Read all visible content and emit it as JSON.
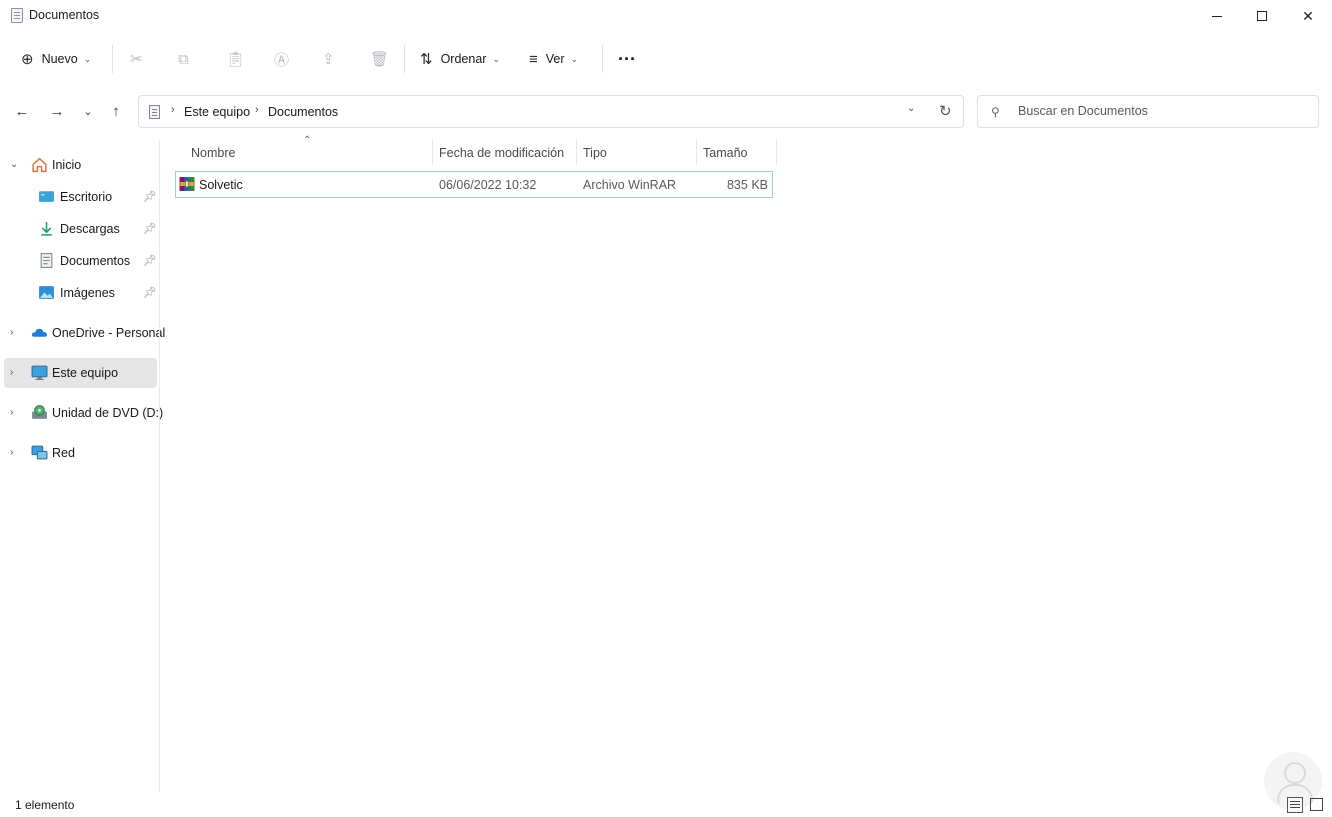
{
  "window": {
    "title": "Documentos",
    "minimize": "—",
    "maximize": "☐",
    "close": "✕"
  },
  "toolbar": {
    "new_label": "Nuevo",
    "sort_label": "Ordenar",
    "view_label": "Ver",
    "more_label": "···",
    "icons": [
      "plus-circle-icon",
      "cut-icon",
      "copy-icon",
      "paste-icon",
      "rename-icon",
      "share-icon",
      "delete-icon",
      "sort-icon",
      "view-icon",
      "more-icon"
    ]
  },
  "address": {
    "crumbs": [
      "Este equipo",
      "Documentos"
    ],
    "separator": "›"
  },
  "search": {
    "placeholder": "Buscar en Documentos"
  },
  "sidebar": {
    "items": [
      {
        "label": "Inicio",
        "icon": "home-icon",
        "expanded": true
      },
      {
        "label": "Escritorio",
        "icon": "desktop-icon",
        "pinned": true
      },
      {
        "label": "Descargas",
        "icon": "download-icon",
        "pinned": true
      },
      {
        "label": "Documentos",
        "icon": "document-icon",
        "pinned": true
      },
      {
        "label": "Imágenes",
        "icon": "pictures-icon",
        "pinned": true
      },
      {
        "label": "OneDrive - Personal",
        "icon": "cloud-icon"
      },
      {
        "label": "Este equipo",
        "icon": "computer-icon",
        "selected": true
      },
      {
        "label": "Unidad de DVD (D:)",
        "icon": "dvd-icon"
      },
      {
        "label": "Red",
        "icon": "network-icon"
      }
    ]
  },
  "files": {
    "columns": {
      "name": "Nombre",
      "modified": "Fecha de modificación",
      "type": "Tipo",
      "size": "Tamaño"
    },
    "rows": [
      {
        "name": "Solvetic",
        "modified": "06/06/2022 10:32",
        "type": "Archivo WinRAR",
        "size": "835 KB",
        "icon": "winrar-icon"
      }
    ]
  },
  "status": {
    "count": "1 elemento"
  },
  "colors": {
    "selected_row_border": "#99d1e6",
    "nav_selected_bg": "#e5e5e5"
  }
}
